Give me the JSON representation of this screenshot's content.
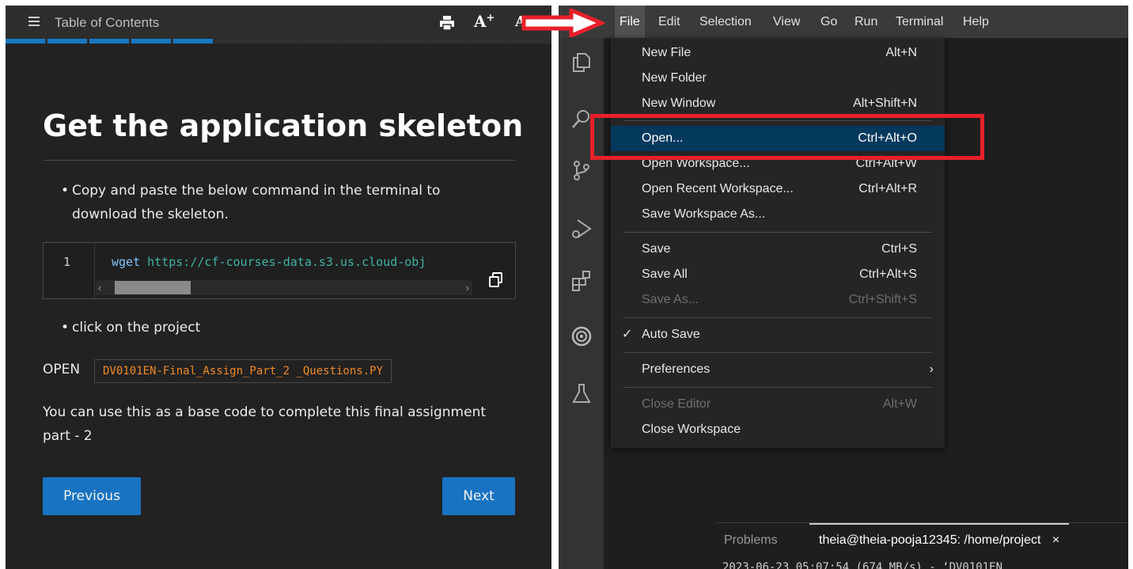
{
  "lesson": {
    "toc_title": "Table of Contents",
    "font_increase_label": "A",
    "font_increase_sup": "+",
    "font_label": "A",
    "progress": {
      "completed_segments": 5,
      "total_segments": 13
    },
    "heading": "Get the application skeleton",
    "bullet_1": "Copy and paste the below command in the terminal to download the skeleton.",
    "code": {
      "line_number": "1",
      "command": "wget",
      "url": "https://cf-courses-data.s3.us.cloud-obj",
      "scroll_left": "‹",
      "scroll_right": "›"
    },
    "bullet_2": "click on the project",
    "open_label": "OPEN",
    "open_file": "DV0101EN-Final_Assign_Part_2 _Questions.PY",
    "paragraph": "You can use this as a base code to complete this final assignment part - 2",
    "prev_button": "Previous",
    "next_button": "Next"
  },
  "ide": {
    "menu": [
      "File",
      "Edit",
      "Selection",
      "View",
      "Go",
      "Run",
      "Terminal",
      "Help"
    ],
    "file_menu": [
      {
        "label": "New File",
        "shortcut": "Alt+N"
      },
      {
        "label": "New Folder",
        "shortcut": ""
      },
      {
        "label": "New Window",
        "shortcut": "Alt+Shift+N"
      },
      {
        "label": "Open...",
        "shortcut": "Ctrl+Alt+O"
      },
      {
        "label": "Open Workspace...",
        "shortcut": "Ctrl+Alt+W"
      },
      {
        "label": "Open Recent Workspace...",
        "shortcut": "Ctrl+Alt+R"
      },
      {
        "label": "Save Workspace As...",
        "shortcut": ""
      },
      {
        "label": "Save",
        "shortcut": "Ctrl+S"
      },
      {
        "label": "Save All",
        "shortcut": "Ctrl+Alt+S"
      },
      {
        "label": "Save As...",
        "shortcut": "Ctrl+Shift+S"
      },
      {
        "label": "Auto Save",
        "shortcut": ""
      },
      {
        "label": "Preferences",
        "shortcut": ""
      },
      {
        "label": "Close Editor",
        "shortcut": "Alt+W"
      },
      {
        "label": "Close Workspace",
        "shortcut": ""
      }
    ],
    "auto_save_check": "✓",
    "submenu_arrow": "›",
    "panel": {
      "problems_tab": "Problems",
      "terminal_tab": "theia@theia-pooja12345: /home/project",
      "close": "×",
      "terminal_line": "2023-06-23 05:07:54 (674 MB/s) - ‘DV0101EN"
    }
  }
}
